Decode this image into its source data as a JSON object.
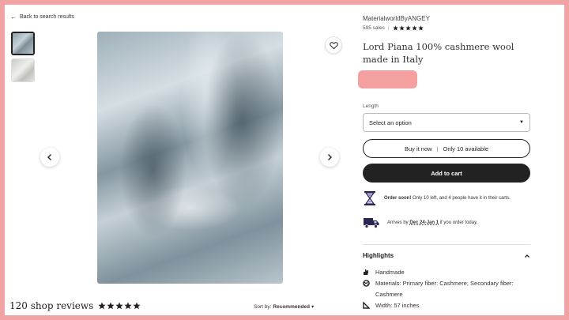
{
  "nav": {
    "back_label": "Back to search results"
  },
  "gallery": {
    "thumbnails": [
      {
        "name": "thumbnail-1",
        "selected": true
      },
      {
        "name": "thumbnail-2",
        "selected": false
      }
    ],
    "prev_icon": "chevron-left-icon",
    "next_icon": "chevron-right-icon",
    "favorite_icon": "heart-icon"
  },
  "reviews": {
    "count_label": "120 shop reviews",
    "stars": 5
  },
  "sort": {
    "prefix": "Sort by:",
    "value": "Recommended"
  },
  "listing": {
    "shop_name": "MaterialworldByANGEY",
    "sales": "595 sales",
    "rating_stars": 5,
    "title": "Lord Piana 100% cashmere wool made in Italy",
    "length_label": "Length",
    "select_placeholder": "Select an option",
    "buy_now_label": "Buy it now",
    "buy_now_sep": "|",
    "availability": "Only 10 available",
    "add_to_cart_label": "Add to cart",
    "order_soon_bold": "Order soon!",
    "order_soon_text": "Only 10 left, and 4 people have it in their carts.",
    "arrives_prefix": "Arrives by",
    "arrives_date": "Dec 24-Jan 1",
    "arrives_suffix": "if you order today.",
    "highlights_label": "Highlights",
    "highlights": [
      {
        "icon": "hand-icon",
        "text": "Handmade"
      },
      {
        "icon": "yarn-icon",
        "text": "Materials: Primary fiber: Cashmere; Secondary fiber: Cashmere"
      },
      {
        "icon": "ruler-icon",
        "text": "Width: 57 inches"
      }
    ]
  },
  "colors": {
    "frame": "#f2a3a3",
    "price_redaction": "#f4a0a0",
    "primary_button": "#222222"
  }
}
